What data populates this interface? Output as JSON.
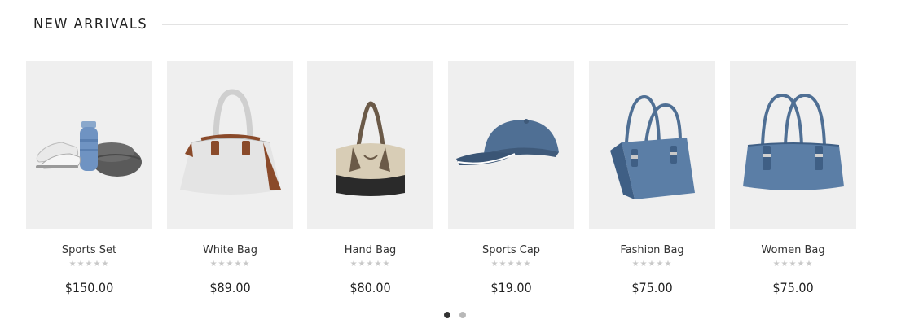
{
  "section": {
    "title": "NEW ARRIVALS"
  },
  "products": [
    {
      "name": "Sports Set",
      "price": "$150.00",
      "rating": "★★★★★",
      "image": "sports-set-image"
    },
    {
      "name": "White Bag",
      "price": "$89.00",
      "rating": "★★★★★",
      "image": "white-bag-image"
    },
    {
      "name": "Hand Bag",
      "price": "$80.00",
      "rating": "★★★★★",
      "image": "hand-bag-image"
    },
    {
      "name": "Sports Cap",
      "price": "$19.00",
      "rating": "★★★★★",
      "image": "sports-cap-image"
    },
    {
      "name": "Fashion Bag",
      "price": "$75.00",
      "rating": "★★★★★",
      "image": "fashion-bag-image"
    },
    {
      "name": "Women Bag",
      "price": "$75.00",
      "rating": "★★★★★",
      "image": "women-bag-image"
    }
  ],
  "carousel": {
    "pages": 2,
    "active_page": 1
  },
  "colors": {
    "star": "#c9c9c9",
    "thumb_bg": "#efefef",
    "dot_active": "#333333",
    "dot_inactive": "#b8b8b8"
  }
}
